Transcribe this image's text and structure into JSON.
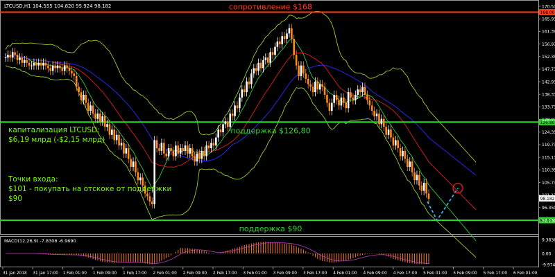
{
  "header": {
    "symbol_info": "LTCUSD,H1  104.555 104.820 95.924 98.182"
  },
  "levels": [
    {
      "price": 168.0,
      "label": "сопротивление $168",
      "color": "#ff3b1f",
      "price_tag": "168.00"
    },
    {
      "price": 126.8,
      "label": "поддержка $126,80",
      "color": "#22dd22",
      "price_tag": "126.80"
    },
    {
      "price": 90.0,
      "label": "поддержка $90",
      "color": "#22dd22",
      "price_tag": "90.00"
    }
  ],
  "annotations": {
    "market_cap_1": "капитализация LTCUSD:",
    "market_cap_2": "$6,19 млрд (-$2,15 млрд)",
    "entry_1": "Точки входа:",
    "entry_2": "$101 - покупать на отскоке от поддержки",
    "entry_3": "$90"
  },
  "current_price": {
    "value": 98.18,
    "tag": "98.182"
  },
  "chart_data": {
    "type": "candlestick",
    "price_axis_ticks": [
      "170.510",
      "165.930",
      "161.390",
      "156.970",
      "152.350",
      "147.730",
      "142.930",
      "138.330",
      "133.730",
      "128.970",
      "124.350",
      "119.730",
      "115.130",
      "110.350",
      "105.730",
      "101.130",
      "96.350",
      "92.150"
    ],
    "ylim": [
      90,
      171
    ],
    "x_labels": [
      "31 Jan 2018",
      "31 Jan 17:00",
      "1 Feb 01:00",
      "1 Feb 09:00",
      "1 Feb 17:00",
      "2 Feb 01:00",
      "2 Feb 09:00",
      "2 Feb 17:00",
      "3 Feb 01:00",
      "3 Feb 09:00",
      "3 Feb 17:00",
      "4 Feb 01:00",
      "4 Feb 09:00",
      "4 Feb 17:00",
      "5 Feb 01:00",
      "5 Feb 09:00",
      "5 Feb 17:00",
      "6 Feb 01:00"
    ],
    "closes": [
      151,
      152,
      151,
      153,
      152,
      150,
      151,
      149,
      150,
      149,
      148,
      148,
      149,
      148,
      149,
      148,
      149,
      148,
      147,
      146,
      148,
      147,
      148,
      147,
      146,
      148,
      147,
      146,
      145,
      144,
      140,
      138,
      135,
      137,
      134,
      131,
      133,
      130,
      128,
      130,
      127,
      129,
      125,
      126,
      122,
      124,
      120,
      122,
      118,
      119,
      115,
      117,
      113,
      110,
      112,
      108,
      105,
      106,
      103,
      100,
      99,
      97,
      96,
      120,
      117,
      116,
      119,
      115,
      114,
      117,
      116,
      114,
      118,
      115,
      117,
      116,
      118,
      115,
      117,
      114,
      112,
      115,
      113,
      116,
      114,
      118,
      117,
      119,
      118,
      121,
      124,
      123,
      126,
      127,
      125,
      130,
      129,
      133,
      132,
      136,
      139,
      138,
      142,
      141,
      145,
      147,
      146,
      149,
      147,
      150,
      151,
      149,
      153,
      152,
      155,
      157,
      156,
      159,
      158,
      160,
      162,
      158,
      152,
      148,
      144,
      148,
      145,
      143,
      141,
      140,
      138,
      142,
      139,
      141,
      140,
      137,
      134,
      131,
      134,
      137,
      135,
      133,
      136,
      134,
      132,
      138,
      136,
      135,
      137,
      139,
      138,
      140,
      137,
      135,
      133,
      131,
      129,
      130,
      126,
      128,
      125,
      122,
      124,
      121,
      118,
      120,
      117,
      114,
      116,
      113,
      110,
      112,
      108,
      105,
      107,
      103,
      101,
      104,
      100,
      98
    ],
    "macd_value_labels": [
      "9.3836",
      "0.00",
      "-9.9745"
    ],
    "macd_label": "MACD(12,26,9) -7.8306 -6.9690"
  }
}
